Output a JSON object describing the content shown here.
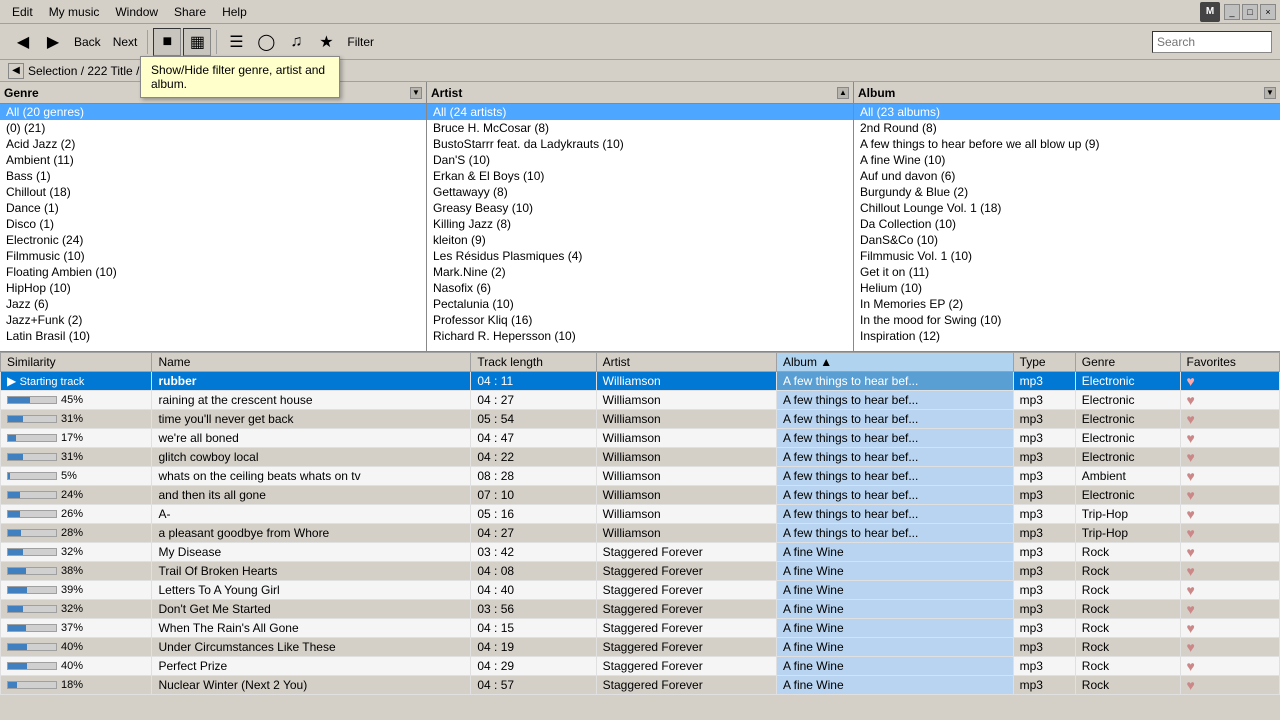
{
  "menubar": {
    "items": [
      "Edit",
      "My music",
      "Window",
      "Share",
      "Help"
    ]
  },
  "toolbar": {
    "back_label": "Back",
    "next_label": "Next",
    "filter_label": "Filter",
    "search_label": "Search",
    "tooltip_text": "Show/Hide filter genre, artist and album."
  },
  "selection_bar": {
    "text": "Selection  /  222 Title  /"
  },
  "genre_panel": {
    "header": "Genre",
    "items": [
      "All (20 genres)",
      "(0)  (21)",
      "Acid Jazz  (2)",
      "Ambient  (11)",
      "Bass  (1)",
      "Chillout  (18)",
      "Dance  (1)",
      "Disco  (1)",
      "Electronic  (24)",
      "Filmmusic  (10)",
      "Floating Ambien  (10)",
      "HipHop  (10)",
      "Jazz  (6)",
      "Jazz+Funk  (2)",
      "Latin Brasil  (10)"
    ]
  },
  "artist_panel": {
    "header": "Artist",
    "items": [
      "All (24 artists)",
      "Bruce H. McCosar  (8)",
      "BustoStarrr feat. da Ladykrauts  (10)",
      "Dan'S  (10)",
      "Erkan & El Boys  (10)",
      "Gettawayy  (8)",
      "Greasy Beasy  (10)",
      "Killing Jazz  (8)",
      "kleiton  (9)",
      "Les Résidus Plasmiques  (4)",
      "Mark.Nine  (2)",
      "Nasofix  (6)",
      "Pectalunia  (10)",
      "Professor Kliq  (16)",
      "Richard R. Hepersson  (10)"
    ]
  },
  "album_panel": {
    "header": "Album",
    "items": [
      "All (23 albums)",
      "2nd Round  (8)",
      "A few things to hear before we all blow up  (9)",
      "A fine Wine  (10)",
      "Auf und davon  (6)",
      "Burgundy & Blue  (2)",
      "Chillout Lounge Vol. 1  (18)",
      "Da Collection  (10)",
      "DanS&Co  (10)",
      "Filmmusic Vol. 1  (10)",
      "Get it on  (11)",
      "Helium  (10)",
      "In Memories EP  (2)",
      "In the mood for Swing  (10)",
      "Inspiration  (12)"
    ]
  },
  "table": {
    "columns": [
      "Similarity",
      "Name",
      "Track length",
      "Artist",
      "Album",
      "Type",
      "Genre",
      "Favorites"
    ],
    "rows": [
      {
        "similarity": -1,
        "pct": "Starting track",
        "name": "rubber",
        "length": "04 : 11",
        "artist": "Williamson",
        "album": "A few things to hear bef...",
        "type": "mp3",
        "genre": "Electronic",
        "fav": true,
        "playing": true,
        "selected": true
      },
      {
        "similarity": 45,
        "pct": "45%",
        "name": "raining at the crescent house",
        "length": "04 : 27",
        "artist": "Williamson",
        "album": "A few things to hear bef...",
        "type": "mp3",
        "genre": "Electronic",
        "fav": true
      },
      {
        "similarity": 31,
        "pct": "31%",
        "name": "time you'll never get back",
        "length": "05 : 54",
        "artist": "Williamson",
        "album": "A few things to hear bef...",
        "type": "mp3",
        "genre": "Electronic",
        "fav": true
      },
      {
        "similarity": 17,
        "pct": "17%",
        "name": "we're all boned",
        "length": "04 : 47",
        "artist": "Williamson",
        "album": "A few things to hear bef...",
        "type": "mp3",
        "genre": "Electronic",
        "fav": true
      },
      {
        "similarity": 31,
        "pct": "31%",
        "name": "glitch cowboy local",
        "length": "04 : 22",
        "artist": "Williamson",
        "album": "A few things to hear bef...",
        "type": "mp3",
        "genre": "Electronic",
        "fav": true
      },
      {
        "similarity": 5,
        "pct": "5%",
        "name": "whats on the ceiling beats whats on tv",
        "length": "08 : 28",
        "artist": "Williamson",
        "album": "A few things to hear bef...",
        "type": "mp3",
        "genre": "Ambient",
        "fav": true
      },
      {
        "similarity": 24,
        "pct": "24%",
        "name": "and then its all gone",
        "length": "07 : 10",
        "artist": "Williamson",
        "album": "A few things to hear bef...",
        "type": "mp3",
        "genre": "Electronic",
        "fav": true
      },
      {
        "similarity": 26,
        "pct": "26%",
        "name": "A-",
        "length": "05 : 16",
        "artist": "Williamson",
        "album": "A few things to hear bef...",
        "type": "mp3",
        "genre": "Trip-Hop",
        "fav": true
      },
      {
        "similarity": 28,
        "pct": "28%",
        "name": "a pleasant goodbye from Whore",
        "length": "04 : 27",
        "artist": "Williamson",
        "album": "A few things to hear bef...",
        "type": "mp3",
        "genre": "Trip-Hop",
        "fav": true
      },
      {
        "similarity": 32,
        "pct": "32%",
        "name": "My Disease",
        "length": "03 : 42",
        "artist": "Staggered Forever",
        "album": "A fine Wine",
        "type": "mp3",
        "genre": "Rock",
        "fav": true
      },
      {
        "similarity": 38,
        "pct": "38%",
        "name": "Trail Of Broken Hearts",
        "length": "04 : 08",
        "artist": "Staggered Forever",
        "album": "A fine Wine",
        "type": "mp3",
        "genre": "Rock",
        "fav": true
      },
      {
        "similarity": 39,
        "pct": "39%",
        "name": "Letters To A Young Girl",
        "length": "04 : 40",
        "artist": "Staggered Forever",
        "album": "A fine Wine",
        "type": "mp3",
        "genre": "Rock",
        "fav": true
      },
      {
        "similarity": 32,
        "pct": "32%",
        "name": "Don't Get Me Started",
        "length": "03 : 56",
        "artist": "Staggered Forever",
        "album": "A fine Wine",
        "type": "mp3",
        "genre": "Rock",
        "fav": true
      },
      {
        "similarity": 37,
        "pct": "37%",
        "name": "When The Rain's All Gone",
        "length": "04 : 15",
        "artist": "Staggered Forever",
        "album": "A fine Wine",
        "type": "mp3",
        "genre": "Rock",
        "fav": true
      },
      {
        "similarity": 40,
        "pct": "40%",
        "name": "Under Circumstances Like These",
        "length": "04 : 19",
        "artist": "Staggered Forever",
        "album": "A fine Wine",
        "type": "mp3",
        "genre": "Rock",
        "fav": true
      },
      {
        "similarity": 40,
        "pct": "40%",
        "name": "Perfect Prize",
        "length": "04 : 29",
        "artist": "Staggered Forever",
        "album": "A fine Wine",
        "type": "mp3",
        "genre": "Rock",
        "fav": true
      },
      {
        "similarity": 18,
        "pct": "18%",
        "name": "Nuclear Winter (Next 2 You)",
        "length": "04 : 57",
        "artist": "Staggered Forever",
        "album": "A fine Wine",
        "type": "mp3",
        "genre": "Rock",
        "fav": true
      }
    ]
  }
}
